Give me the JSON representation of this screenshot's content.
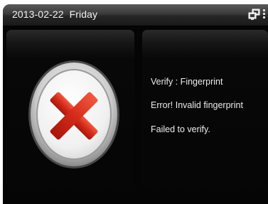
{
  "statusbar": {
    "date": "2013-02-22",
    "weekday": "Friday",
    "icons": [
      "network-icon",
      "menu-grip-icon"
    ]
  },
  "result": {
    "icon": "failure-cross-icon",
    "colors": {
      "cross": "#d42a1a",
      "disc": "#f4f4f4",
      "ring": "#b8b8b8"
    }
  },
  "messages": {
    "verify_mode": "Verify : Fingerprint",
    "error": "Error! Invalid fingerprint",
    "status": "Failed to verify."
  }
}
